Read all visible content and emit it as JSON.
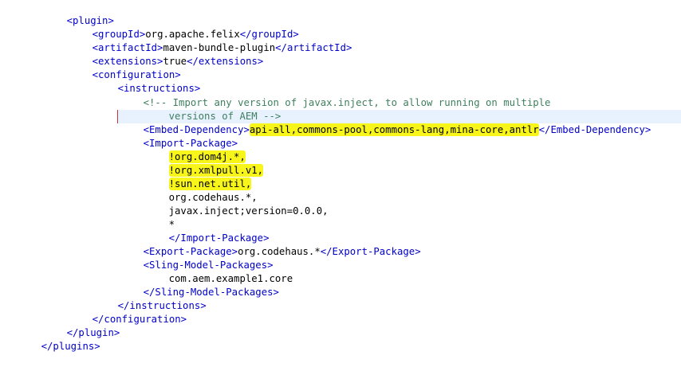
{
  "lines": [
    {
      "open": "<plugin>"
    },
    {
      "open": "<groupId>",
      "value": "org.apache.felix",
      "close": "</groupId>"
    },
    {
      "open": "<artifactId>",
      "value": "maven-bundle-plugin",
      "close": "</artifactId>"
    },
    {
      "open": "<extensions>",
      "value": "true",
      "close": "</extensions>"
    },
    {
      "open": "<configuration>"
    },
    {
      "open": "<instructions>"
    },
    {
      "comment1": "<!-- Import any version of javax.inject, to allow running on multiple",
      "comment2": "versions of AEM -->"
    },
    {
      "open": "<Embed-Dependency>",
      "value": "api-all,commons-pool,commons-lang,mina-core,antlr",
      "close": "</Embed-Dependency>"
    },
    {
      "open": "<Import-Package>"
    },
    {
      "value": "!org.dom4j.*,"
    },
    {
      "value": "!org.xmlpull.v1,"
    },
    {
      "value": "!sun.net.util,"
    },
    {
      "value": "org.codehaus.*,"
    },
    {
      "value": "javax.inject;version=0.0.0,"
    },
    {
      "value": "*"
    },
    {
      "close": "</Import-Package>"
    },
    {
      "open": "<Export-Package>",
      "value": "org.codehaus.*",
      "close": "</Export-Package>"
    },
    {
      "open": "<Sling-Model-Packages>"
    },
    {
      "value": "com.aem.example1.core"
    },
    {
      "close": "</Sling-Model-Packages>"
    },
    {
      "close": "</instructions>"
    },
    {
      "close": "</configuration>"
    },
    {
      "close": "</plugin>"
    },
    {
      "close": "</plugins>"
    }
  ]
}
